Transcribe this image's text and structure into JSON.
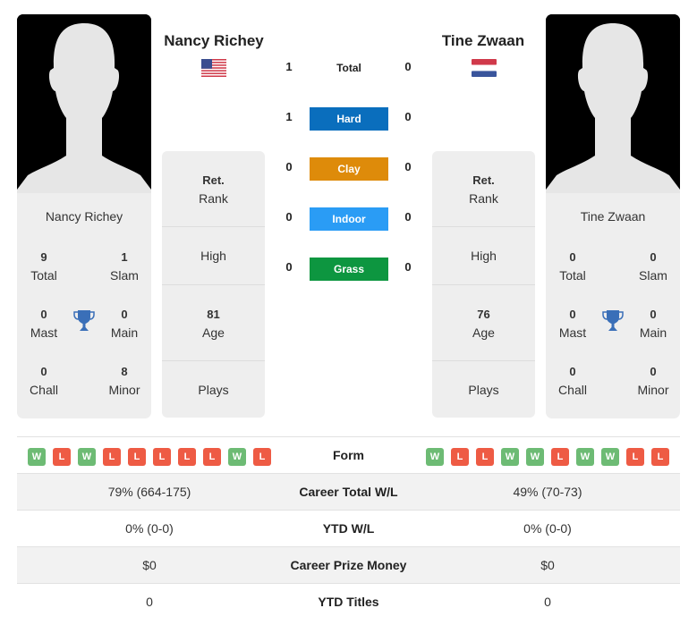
{
  "colors": {
    "hard": "#0a6ebd",
    "clay": "#de8b0a",
    "indoor": "#2a9cf5",
    "grass": "#0d9640",
    "win": "#6dbb74",
    "loss": "#ee5b44",
    "trophy": "#3a6fb8"
  },
  "player1": {
    "name": "Nancy Richey",
    "flag": "usa-flag",
    "card_name": "Nancy Richey",
    "titles": {
      "total": {
        "value": "9",
        "label": "Total"
      },
      "slam": {
        "value": "1",
        "label": "Slam"
      },
      "mast": {
        "value": "0",
        "label": "Mast"
      },
      "main": {
        "value": "0",
        "label": "Main"
      },
      "chall": {
        "value": "0",
        "label": "Chall"
      },
      "minor": {
        "value": "8",
        "label": "Minor"
      }
    },
    "info": {
      "rank_value": "Ret.",
      "rank_label": "Rank",
      "high_label": "High",
      "age_value": "81",
      "age_label": "Age",
      "plays_label": "Plays"
    },
    "form": [
      "W",
      "L",
      "W",
      "L",
      "L",
      "L",
      "L",
      "L",
      "W",
      "L"
    ]
  },
  "player2": {
    "name": "Tine Zwaan",
    "flag": "netherlands-flag",
    "card_name": "Tine Zwaan",
    "titles": {
      "total": {
        "value": "0",
        "label": "Total"
      },
      "slam": {
        "value": "0",
        "label": "Slam"
      },
      "mast": {
        "value": "0",
        "label": "Mast"
      },
      "main": {
        "value": "0",
        "label": "Main"
      },
      "chall": {
        "value": "0",
        "label": "Chall"
      },
      "minor": {
        "value": "0",
        "label": "Minor"
      }
    },
    "info": {
      "rank_value": "Ret.",
      "rank_label": "Rank",
      "high_label": "High",
      "age_value": "76",
      "age_label": "Age",
      "plays_label": "Plays"
    },
    "form": [
      "W",
      "L",
      "L",
      "W",
      "W",
      "L",
      "W",
      "W",
      "L",
      "L"
    ]
  },
  "h2h": {
    "total": {
      "label": "Total",
      "p1": "1",
      "p2": "0"
    },
    "hard": {
      "label": "Hard",
      "p1": "1",
      "p2": "0"
    },
    "clay": {
      "label": "Clay",
      "p1": "0",
      "p2": "0"
    },
    "indoor": {
      "label": "Indoor",
      "p1": "0",
      "p2": "0"
    },
    "grass": {
      "label": "Grass",
      "p1": "0",
      "p2": "0"
    }
  },
  "comparison": {
    "form_label": "Form",
    "rows": [
      {
        "label": "Career Total W/L",
        "p1": "79% (664-175)",
        "p2": "49% (70-73)"
      },
      {
        "label": "YTD W/L",
        "p1": "0% (0-0)",
        "p2": "0% (0-0)"
      },
      {
        "label": "Career Prize Money",
        "p1": "$0",
        "p2": "$0"
      },
      {
        "label": "YTD Titles",
        "p1": "0",
        "p2": "0"
      }
    ]
  }
}
